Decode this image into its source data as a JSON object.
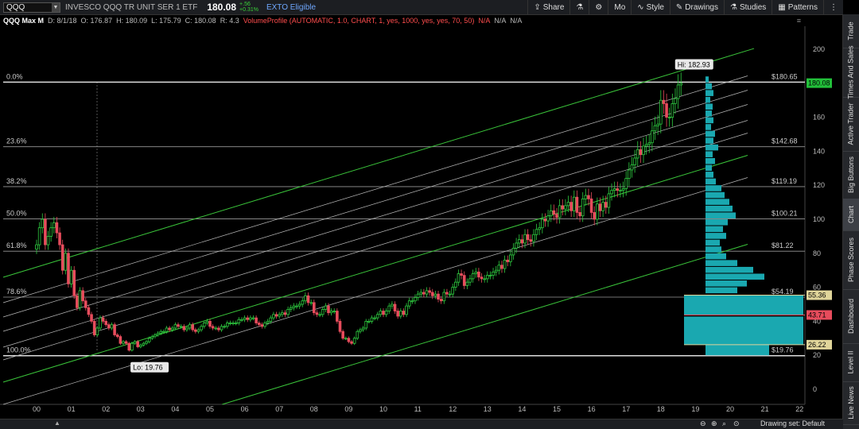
{
  "toolbar": {
    "symbol": "QQQ",
    "description": "INVESCO QQQ TR UNIT SER 1 ETF",
    "last": "180.08",
    "change_abs": "+.56",
    "change_pct": "+0.31%",
    "exto": "EXTO Eligible",
    "share": "Share",
    "mo": "Mo",
    "style": "Style",
    "drawings": "Drawings",
    "studies": "Studies",
    "patterns": "Patterns"
  },
  "info": {
    "title": "QQQ Max M",
    "date": "D: 8/1/18",
    "open": "O: 176.87",
    "high": "H: 180.09",
    "low": "L: 175.79",
    "close": "C: 180.08",
    "range": "R: 4.3",
    "study": "VolumeProfile (AUTOMATIC, 1.0, CHART, 1, yes, 1000, yes, yes, 70, 50)",
    "na1": "N/A",
    "na2": "N/A",
    "na3": "N/A"
  },
  "sidebar": [
    "Trade",
    "Times And Sales",
    "Active Trader",
    "Big Buttons",
    "Chart",
    "Phase Scores",
    "Dashboard",
    "Level II",
    "Live News"
  ],
  "bottom": {
    "drawing_set": "Drawing set: Default"
  },
  "colors": {
    "up": "#2ecc40",
    "down": "#e74c5c",
    "profile": "#1aa8b0",
    "channel": "#3ac43a",
    "fib": "#aaaaaa",
    "price_tag": "#22c03a"
  },
  "chart_data": {
    "type": "candlestick",
    "x_tick_labels": [
      "00",
      "01",
      "02",
      "03",
      "04",
      "05",
      "06",
      "07",
      "08",
      "09",
      "10",
      "11",
      "12",
      "13",
      "14",
      "15",
      "16",
      "17",
      "18",
      "19",
      "20",
      "21",
      "22"
    ],
    "y_ticks": [
      0,
      20,
      40,
      60,
      80,
      100,
      120,
      140,
      160,
      180,
      200
    ],
    "ylim": [
      -15,
      212
    ],
    "fib_levels": [
      {
        "pct": "0.0%",
        "price": 180.65,
        "price_label": "$180.65"
      },
      {
        "pct": "23.6%",
        "price": 142.68,
        "price_label": "$142.68"
      },
      {
        "pct": "38.2%",
        "price": 119.19,
        "price_label": "$119.19"
      },
      {
        "pct": "50.0%",
        "price": 100.21,
        "price_label": "$100.21"
      },
      {
        "pct": "61.8%",
        "price": 81.22,
        "price_label": "$81.22"
      },
      {
        "pct": "78.6%",
        "price": 54.19,
        "price_label": "$54.19"
      },
      {
        "pct": "100.0%",
        "price": 19.76,
        "price_label": "$19.76"
      }
    ],
    "high_label": "Hi: 182.93",
    "low_label": "Lo: 19.76",
    "price_tags": [
      {
        "value": "180.08",
        "color": "#22c03a"
      },
      {
        "value": "55.36",
        "color": "#e0d59a"
      },
      {
        "value": "43.71",
        "color": "#e74c5c"
      },
      {
        "value": "26.22",
        "color": "#e0d59a"
      }
    ],
    "monthly_closes_by_year": [
      {
        "year": 2000,
        "close": [
          85,
          95,
          100,
          85,
          90,
          95,
          98,
          92,
          85,
          70,
          80,
          62
        ]
      },
      {
        "year": 2001,
        "close": [
          70,
          55,
          48,
          58,
          52,
          48,
          44,
          40,
          32,
          36,
          42,
          40
        ]
      },
      {
        "year": 2002,
        "close": [
          38,
          36,
          38,
          32,
          31,
          27,
          28,
          27,
          23,
          27,
          28,
          25
        ]
      },
      {
        "year": 2003,
        "close": [
          26,
          27,
          28,
          30,
          31,
          32,
          33,
          34,
          34,
          36,
          35,
          36
        ]
      },
      {
        "year": 2004,
        "close": [
          38,
          37,
          37,
          35,
          36,
          38,
          35,
          34,
          35,
          37,
          39,
          40
        ]
      },
      {
        "year": 2005,
        "close": [
          37,
          36,
          36,
          35,
          37,
          37,
          39,
          39,
          39,
          39,
          41,
          41
        ]
      },
      {
        "year": 2006,
        "close": [
          42,
          41,
          42,
          42,
          39,
          38,
          37,
          39,
          40,
          42,
          44,
          43
        ]
      },
      {
        "year": 2007,
        "close": [
          44,
          45,
          44,
          47,
          48,
          49,
          49,
          50,
          52,
          55,
          51,
          51
        ]
      },
      {
        "year": 2008,
        "close": [
          45,
          44,
          44,
          47,
          49,
          45,
          46,
          46,
          40,
          34,
          30,
          30
        ]
      },
      {
        "year": 2009,
        "close": [
          28,
          27,
          30,
          34,
          35,
          36,
          40,
          40,
          42,
          42,
          44,
          46
        ]
      },
      {
        "year": 2010,
        "close": [
          44,
          46,
          49,
          50,
          46,
          43,
          46,
          44,
          49,
          52,
          52,
          54
        ]
      },
      {
        "year": 2011,
        "close": [
          56,
          57,
          56,
          58,
          57,
          55,
          56,
          53,
          52,
          57,
          56,
          56
        ]
      },
      {
        "year": 2012,
        "close": [
          60,
          63,
          68,
          67,
          61,
          63,
          65,
          68,
          69,
          66,
          65,
          65
        ]
      },
      {
        "year": 2013,
        "close": [
          67,
          67,
          69,
          70,
          73,
          71,
          76,
          75,
          79,
          83,
          86,
          88
        ]
      },
      {
        "year": 2014,
        "close": [
          86,
          91,
          88,
          87,
          91,
          94,
          95,
          100,
          99,
          102,
          105,
          103
        ]
      },
      {
        "year": 2015,
        "close": [
          101,
          108,
          106,
          108,
          110,
          105,
          113,
          104,
          102,
          112,
          114,
          112
        ]
      },
      {
        "year": 2016,
        "close": [
          104,
          100,
          109,
          105,
          110,
          107,
          115,
          117,
          118,
          117,
          117,
          118
        ]
      },
      {
        "year": 2017,
        "close": [
          124,
          129,
          132,
          136,
          141,
          138,
          143,
          144,
          145,
          152,
          155,
          156
        ]
      },
      {
        "year": 2018,
        "close": [
          170,
          168,
          160,
          160,
          168,
          171,
          179,
          180
        ]
      }
    ]
  }
}
